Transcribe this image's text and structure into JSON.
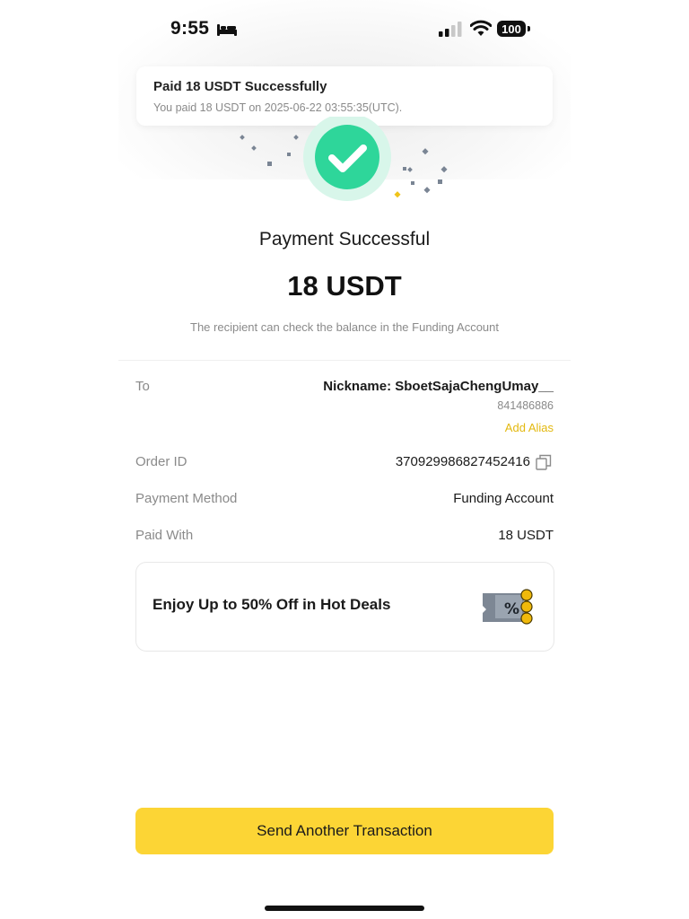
{
  "status_bar": {
    "time": "9:55",
    "battery": "100",
    "icons": [
      "bed-icon",
      "signal-icon",
      "wifi-icon",
      "battery-icon"
    ]
  },
  "toast": {
    "title": "Paid 18 USDT Successfully",
    "message": "You paid 18 USDT on 2025-06-22 03:55:35(UTC)."
  },
  "result": {
    "title": "Payment Successful",
    "amount": "18 USDT",
    "note": "The recipient can check the balance in the Funding Account",
    "icon": "check-circle-icon"
  },
  "details": {
    "to_label": "To",
    "nickname": "Nickname: SboetSajaChengUmay__",
    "user_id": "841486886",
    "add_alias": "Add Alias",
    "order_id_label": "Order ID",
    "order_id": "370929986827452416",
    "payment_method_label": "Payment Method",
    "payment_method": "Funding Account",
    "paid_with_label": "Paid With",
    "paid_with": "18 USDT"
  },
  "promo": {
    "text": "Enjoy Up to 50% Off in Hot Deals",
    "icon": "coupon-icon"
  },
  "cta": {
    "label": "Send Another Transaction"
  },
  "colors": {
    "accent": "#fcd535",
    "success": "#2ed69a",
    "link": "#e3b80e"
  }
}
